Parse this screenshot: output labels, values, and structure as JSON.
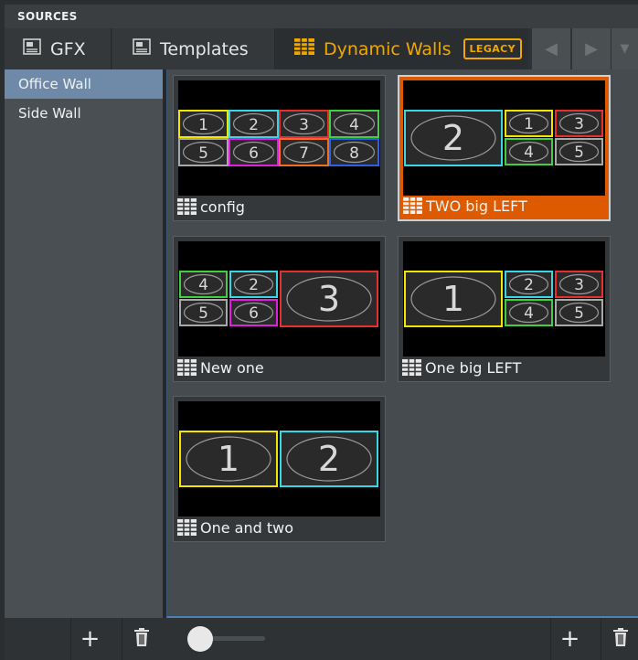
{
  "header": {
    "title": "SOURCES"
  },
  "tabs": [
    {
      "label": "GFX",
      "icon": "gfx-icon"
    },
    {
      "label": "Templates",
      "icon": "templates-icon"
    },
    {
      "label": "Dynamic Walls",
      "icon": "grid-icon",
      "badge": "LEGACY",
      "active": true
    }
  ],
  "nav": {
    "prev": "◀",
    "next": "▶",
    "more": "▼"
  },
  "sidebar": {
    "items": [
      {
        "label": "Office Wall",
        "selected": true
      },
      {
        "label": "Side Wall",
        "selected": false
      }
    ]
  },
  "layouts": [
    {
      "name": "config",
      "selected": false,
      "cells": [
        "1",
        "2",
        "3",
        "4",
        "5",
        "6",
        "7",
        "8"
      ]
    },
    {
      "name": "TWO big LEFT",
      "selected": true,
      "cells": [
        "2",
        "1",
        "3",
        "4",
        "5"
      ]
    },
    {
      "name": "New one",
      "selected": false,
      "cells": [
        "4",
        "2",
        "3",
        "5",
        "6"
      ]
    },
    {
      "name": "One big LEFT",
      "selected": false,
      "cells": [
        "1",
        "2",
        "3",
        "4",
        "5"
      ]
    },
    {
      "name": "One and two",
      "selected": false,
      "cells": [
        "1",
        "2"
      ]
    }
  ],
  "colors": {
    "yellow": "#f2e600",
    "cyan": "#38d6e6",
    "red": "#e63030",
    "green": "#40d040",
    "gray": "#a8a8a8",
    "magenta": "#e020e0",
    "orange": "#f07020",
    "blue": "#3060e0",
    "accent": "#f0a800",
    "selected": "#dd5a00"
  },
  "footer": {
    "add_label": "+",
    "delete_icon": "trash-icon"
  }
}
